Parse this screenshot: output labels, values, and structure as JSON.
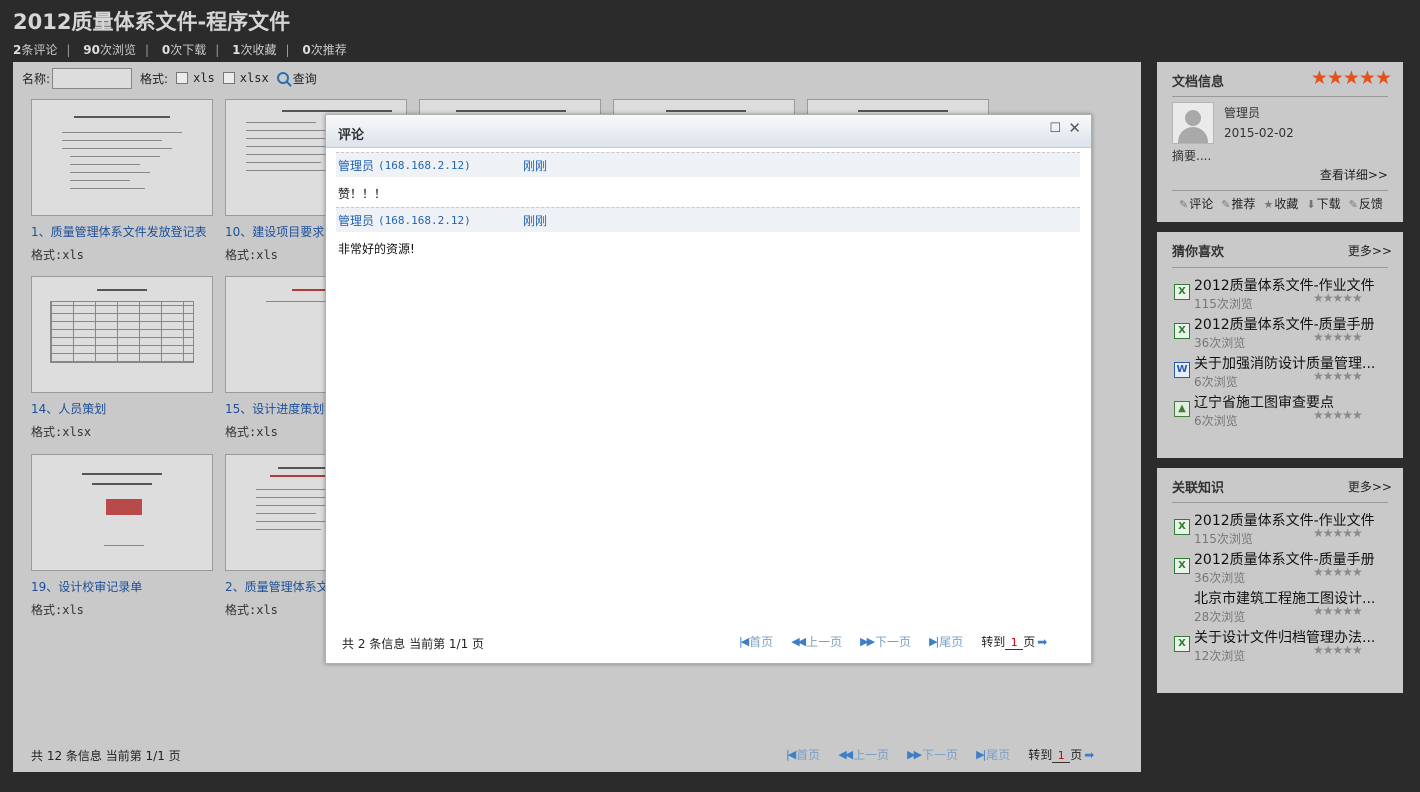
{
  "header": {
    "title": "2012质量体系文件-程序文件",
    "stats": [
      {
        "num": "2",
        "label": "条评论"
      },
      {
        "num": "90",
        "label": "次浏览"
      },
      {
        "num": "0",
        "label": "次下载"
      },
      {
        "num": "1",
        "label": "次收藏"
      },
      {
        "num": "0",
        "label": "次推荐"
      }
    ]
  },
  "filter": {
    "name_label": "名称:",
    "name_value": "",
    "format_label": "格式:",
    "opt_xls": "xls",
    "opt_xlsx": "xlsx",
    "query_label": "查询"
  },
  "docs": [
    {
      "title": "1、质量管理体系文件发放登记表",
      "format": "格式:xls"
    },
    {
      "title": "10、建设项目要求",
      "format": "格式:xls"
    },
    {
      "title": "14、人员策划",
      "format": "格式:xlsx"
    },
    {
      "title": "15、设计进度策划",
      "format": "格式:xls"
    },
    {
      "title": "19、设计校审记录单",
      "format": "格式:xls"
    },
    {
      "title": "2、质量管理体系文",
      "format": "格式:xls"
    }
  ],
  "main_pager": {
    "info": "共 12 条信息 当前第 1/1 页",
    "first": "首页",
    "prev": "上一页",
    "next": "下一页",
    "last": "尾页",
    "goto_label": "转到",
    "goto_value": "1",
    "page_suffix": "页"
  },
  "modal": {
    "title": "评论",
    "comments": [
      {
        "author": "管理员",
        "ip": "(168.168.2.12)",
        "time": "刚刚",
        "text": "赞！！！"
      },
      {
        "author": "管理员",
        "ip": "(168.168.2.12)",
        "time": "刚刚",
        "text": "非常好的资源!"
      }
    ],
    "pager": {
      "info": "共 2 条信息 当前第 1/1 页",
      "first": "首页",
      "prev": "上一页",
      "next": "下一页",
      "last": "尾页",
      "goto_label": "转到",
      "goto_value": "1",
      "page_suffix": "页"
    }
  },
  "doc_info": {
    "title": "文档信息",
    "rating": 5,
    "author": "管理员",
    "date": "2015-02-02",
    "summary": "摘要....",
    "details_link": "查看详细>>",
    "actions": [
      "评论",
      "推荐",
      "收藏",
      "下载",
      "反馈"
    ]
  },
  "guess": {
    "title": "猜你喜欢",
    "more": "更多>>",
    "items": [
      {
        "icon": "excel-icon",
        "title": "2012质量体系文件-作业文件",
        "views": "115次浏览"
      },
      {
        "icon": "excel-icon",
        "title": "2012质量体系文件-质量手册",
        "views": "36次浏览"
      },
      {
        "icon": "word-icon",
        "title": "关于加强消防设计质量管理...",
        "views": "6次浏览"
      },
      {
        "icon": "image-icon",
        "title": "辽宁省施工图审查要点",
        "views": "6次浏览"
      }
    ]
  },
  "related": {
    "title": "关联知识",
    "more": "更多>>",
    "items": [
      {
        "icon": "excel-icon",
        "title": "2012质量体系文件-作业文件",
        "views": "115次浏览"
      },
      {
        "icon": "excel-icon",
        "title": "2012质量体系文件-质量手册",
        "views": "36次浏览"
      },
      {
        "icon": "",
        "title": "北京市建筑工程施工图设计...",
        "views": "28次浏览"
      },
      {
        "icon": "excel-icon",
        "title": "关于设计文件归档管理办法...",
        "views": "12次浏览"
      }
    ]
  },
  "colors": {
    "accent": "#1c4f9a",
    "star": "#e0531f",
    "background": "#2b2b2b",
    "panel": "#c9c9c9"
  }
}
